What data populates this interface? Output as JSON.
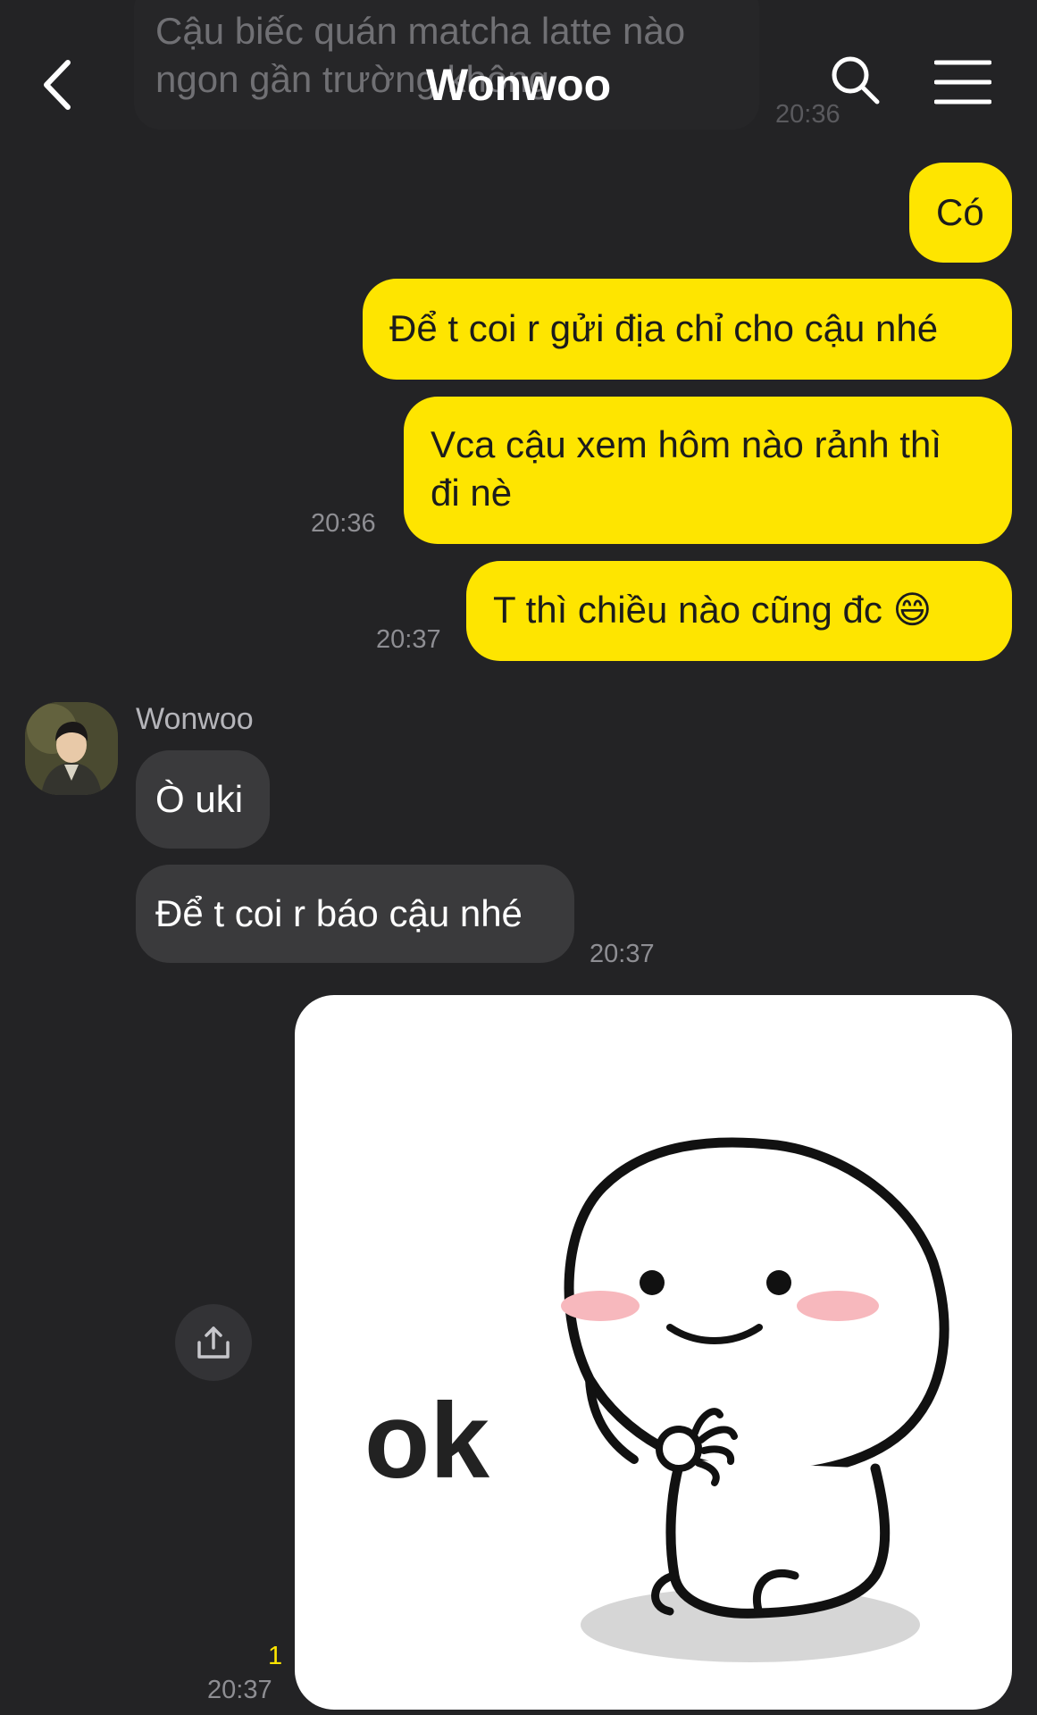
{
  "header": {
    "title": "Wonwoo"
  },
  "previous": {
    "text": "Cậu biếc quán matcha latte nào ngon gần trường không",
    "time": "20:36"
  },
  "messages": {
    "m1": {
      "text": "Có"
    },
    "m2": {
      "text": "Để t coi r gửi địa chỉ cho cậu nhé"
    },
    "m3": {
      "text": "Vca cậu xem hôm nào rảnh thì đi nè",
      "time": "20:36"
    },
    "m4": {
      "text": "T thì chiều nào cũng đc 😄",
      "time": "20:37"
    },
    "r1": {
      "text": "Ò uki"
    },
    "r2": {
      "text": "Để t coi r báo cậu nhé",
      "time": "20:37"
    }
  },
  "contact": {
    "name": "Wonwoo"
  },
  "sticker": {
    "text": "ok",
    "unread": "1",
    "time": "20:37"
  },
  "icons": {
    "back": "chevron-left-icon",
    "search": "search-icon",
    "menu": "hamburger-menu-icon",
    "share": "share-icon"
  },
  "colors": {
    "background": "#232325",
    "my_bubble": "#fee500",
    "their_bubble": "#3a3a3c",
    "unread": "#fee500"
  }
}
